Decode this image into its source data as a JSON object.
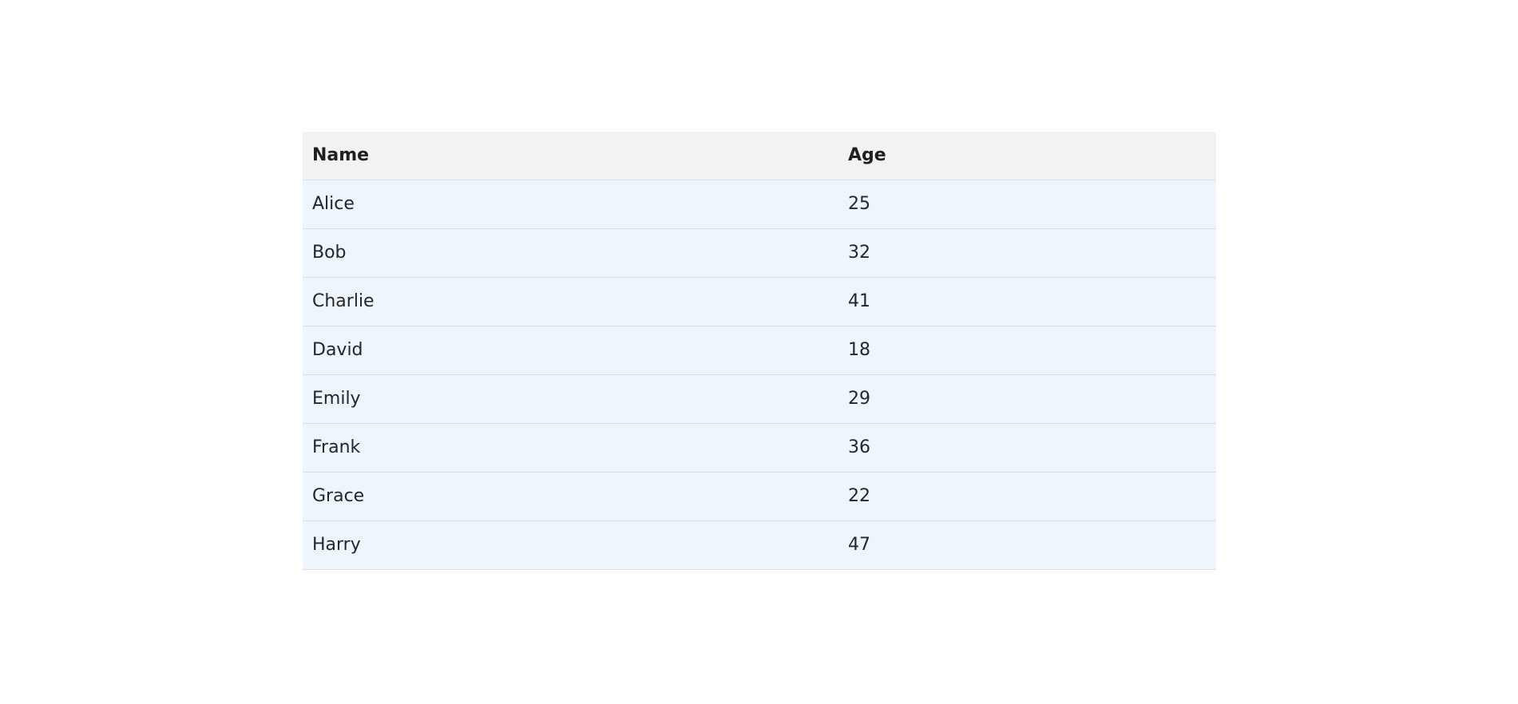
{
  "table": {
    "headers": [
      "Name",
      "Age"
    ],
    "rows": [
      {
        "name": "Alice",
        "age": "25"
      },
      {
        "name": "Bob",
        "age": "32"
      },
      {
        "name": "Charlie",
        "age": "41"
      },
      {
        "name": "David",
        "age": "18"
      },
      {
        "name": "Emily",
        "age": "29"
      },
      {
        "name": "Frank",
        "age": "36"
      },
      {
        "name": "Grace",
        "age": "22"
      },
      {
        "name": "Harry",
        "age": "47"
      }
    ]
  },
  "colors": {
    "header_bg": "#f2f2f2",
    "row_bg": "#eef6fd",
    "divider": "#d6dde4"
  }
}
